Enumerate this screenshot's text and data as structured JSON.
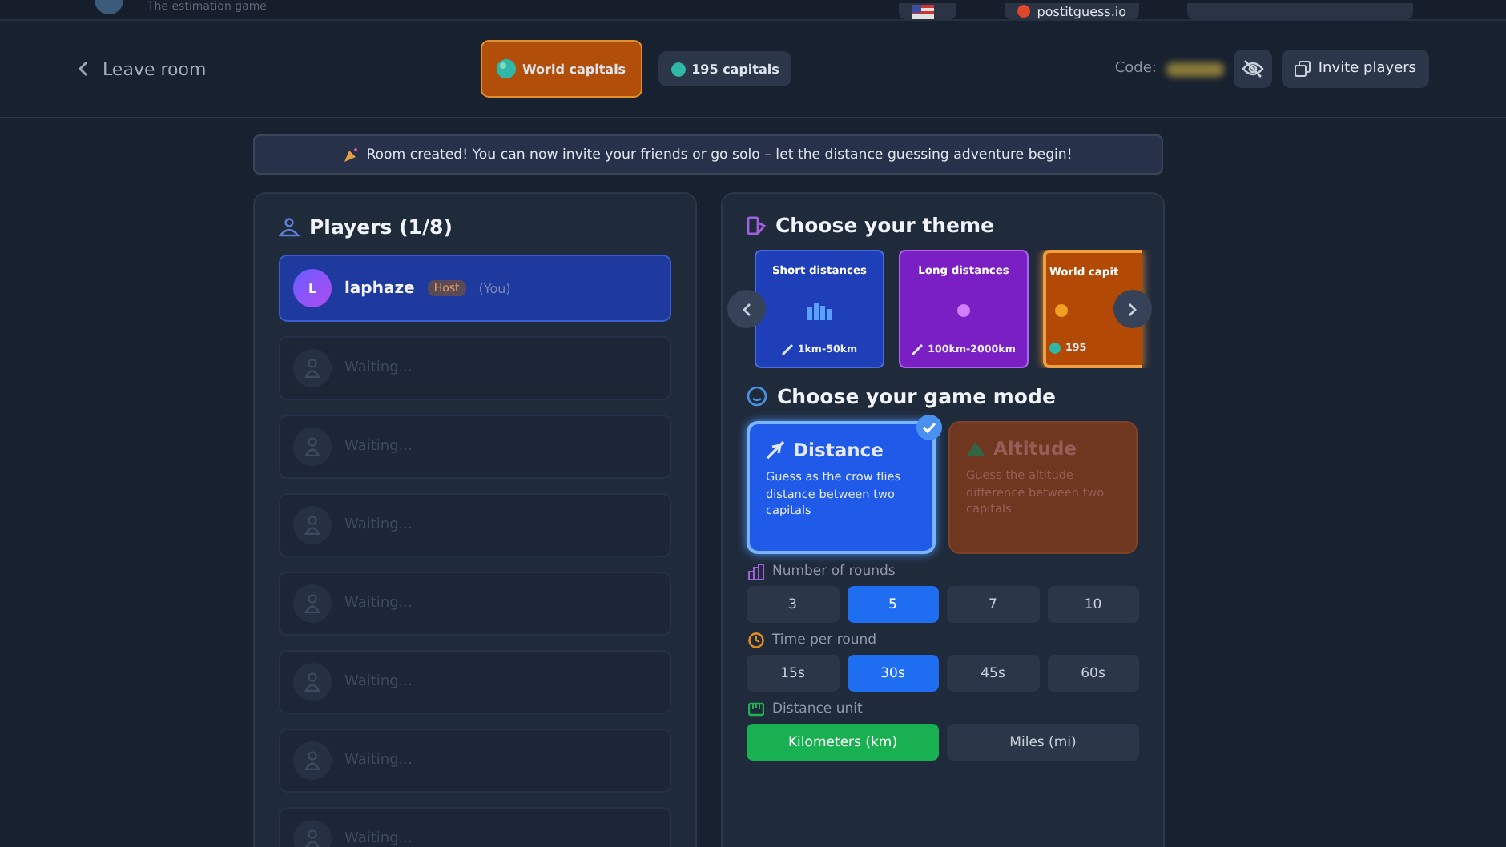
{
  "header": {
    "tagline": "The estimation game",
    "site": "postitguess.io"
  },
  "nav": {
    "back": "Leave room",
    "theme_chip": "World capitals",
    "count_chip": "195 capitals",
    "code_label": "Code:",
    "invite": "Invite players"
  },
  "banner": "Room created! You can now invite your friends or go solo – let the distance guessing adventure begin!",
  "players": {
    "title": "Players (1/8)",
    "slots": [
      {
        "kind": "host",
        "initial": "L",
        "name": "laphaze",
        "badge": "Host",
        "tag": "(You)"
      },
      {
        "kind": "empty",
        "label": "Waiting..."
      },
      {
        "kind": "empty",
        "label": "Waiting..."
      },
      {
        "kind": "empty",
        "label": "Waiting..."
      },
      {
        "kind": "empty",
        "label": "Waiting..."
      },
      {
        "kind": "empty",
        "label": "Waiting..."
      },
      {
        "kind": "empty",
        "label": "Waiting..."
      },
      {
        "kind": "empty",
        "label": "Waiting..."
      }
    ]
  },
  "themes": {
    "title": "Choose your theme",
    "items": [
      {
        "kind": "short",
        "title": "Short distances",
        "footer": "1km-50km",
        "color": "#1f3fb8",
        "selected": false
      },
      {
        "kind": "long",
        "title": "Long distances",
        "footer": "100km-2000km",
        "color": "#7a1fc4",
        "selected": false
      },
      {
        "kind": "capitals",
        "title": "World capit",
        "footer": "195",
        "color": "#b24a05",
        "selected": true
      }
    ]
  },
  "modes": {
    "title": "Choose your game mode",
    "items": [
      {
        "kind": "distance",
        "title": "Distance",
        "description": "Guess as the crow flies distance between two capitals",
        "selected": true
      },
      {
        "kind": "altitude",
        "title": "Altitude",
        "description": "Guess the altitude difference between two capitals",
        "selected": false
      }
    ]
  },
  "settings": [
    {
      "kind": "rounds",
      "label": "Number of rounds",
      "options": [
        {
          "label": "3",
          "selected": false
        },
        {
          "label": "5",
          "selected": true
        },
        {
          "label": "7",
          "selected": false
        },
        {
          "label": "10",
          "selected": false
        }
      ]
    },
    {
      "kind": "time",
      "label": "Time per round",
      "options": [
        {
          "label": "15s",
          "selected": false
        },
        {
          "label": "30s",
          "selected": true
        },
        {
          "label": "45s",
          "selected": false
        },
        {
          "label": "60s",
          "selected": false
        }
      ]
    },
    {
      "kind": "unit",
      "label": "Distance unit",
      "options": [
        {
          "label": "Kilometers (km)",
          "selected": true
        },
        {
          "label": "Miles (mi)",
          "selected": false
        }
      ]
    }
  ]
}
